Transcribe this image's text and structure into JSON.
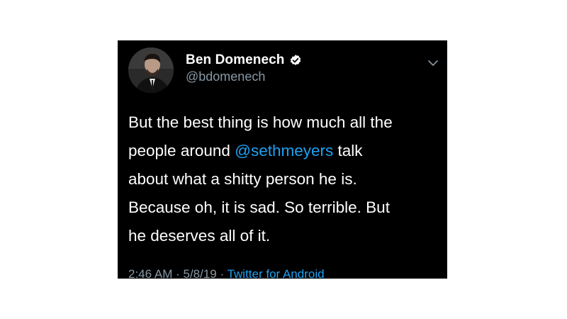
{
  "tweet": {
    "author": {
      "display_name": "Ben Domenech",
      "handle": "@bdomenech",
      "verified": true
    },
    "body": {
      "line1": "But the best thing is how much all the",
      "line2_pre": "people around ",
      "line2_mention": "@sethmeyers",
      "line2_post": " talk",
      "line3": "about what a shitty person he is.",
      "line4": "Because oh, it is sad. So terrible. But",
      "line5": "he deserves all of it."
    },
    "meta": {
      "time": "2:46 AM",
      "separator": " · ",
      "date": "5/8/19",
      "separator2": " · ",
      "source": "Twitter for Android"
    }
  },
  "colors": {
    "background": "#000000",
    "text": "#ffffff",
    "secondary_text": "#8899a6",
    "accent": "#1da1f2"
  },
  "icons": {
    "verified": "verified-badge-icon",
    "caret": "chevron-down-icon"
  }
}
